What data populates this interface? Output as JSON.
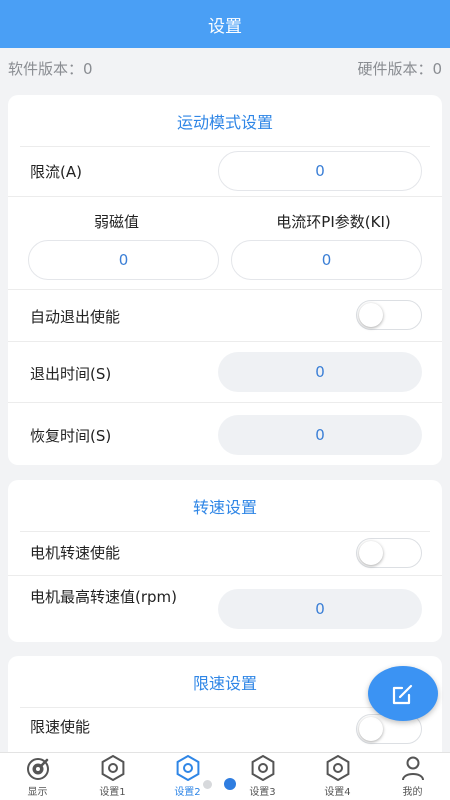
{
  "header": {
    "title": "设置"
  },
  "versions": {
    "software": "软件版本：0",
    "hardware": "硬件版本：0"
  },
  "motion": {
    "title": "运动模式设置",
    "current_limit_label": "限流(A)",
    "current_limit_value": "0",
    "field_weakening_label": "弱磁值",
    "field_weakening_value": "0",
    "pi_ki_label": "电流环PI参数(KI)",
    "pi_ki_value": "0",
    "auto_exit_label": "自动退出使能",
    "auto_exit_on": false,
    "exit_time_label": "退出时间(S)",
    "exit_time_value": "0",
    "recovery_time_label": "恢复时间(S)",
    "recovery_time_value": "0"
  },
  "speed": {
    "title": "转速设置",
    "motor_speed_enable_label": "电机转速使能",
    "motor_speed_enable_on": false,
    "max_speed_label": "电机最高转速值(rpm)",
    "max_speed_value": "0"
  },
  "limit": {
    "title": "限速设置",
    "limit_enable_label": "限速使能",
    "limit_enable_on": false
  },
  "tabs": [
    {
      "label": "显示",
      "icon": "dashboard-icon"
    },
    {
      "label": "设置1",
      "icon": "hex-nut-icon"
    },
    {
      "label": "设置2",
      "icon": "hex-nut-icon",
      "active": true
    },
    {
      "label": "设置3",
      "icon": "hex-nut-icon"
    },
    {
      "label": "设置4",
      "icon": "hex-nut-icon"
    },
    {
      "label": "我的",
      "icon": "user-icon"
    }
  ],
  "colors": {
    "accent": "#4a9ff5",
    "title": "#2f86e6",
    "value": "#3b7fd6"
  }
}
